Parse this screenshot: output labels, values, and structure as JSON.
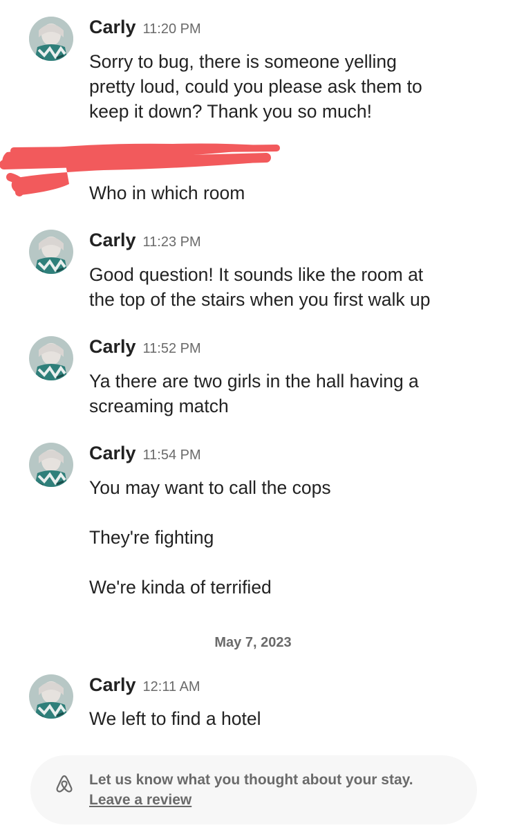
{
  "messages": [
    {
      "name": "Carly",
      "time": "11:20 PM",
      "lines": [
        "Sorry to bug, there is someone yelling",
        "pretty loud, could you please ask them to",
        "keep it down? Thank you so much!"
      ]
    },
    {
      "lines": [
        "Who in which room"
      ]
    },
    {
      "name": "Carly",
      "time": "11:23 PM",
      "lines": [
        "Good question! It sounds like the room at",
        "the top of the stairs when you first walk up"
      ]
    },
    {
      "name": "Carly",
      "time": "11:52 PM",
      "lines": [
        "Ya there are two girls in the hall having a",
        "screaming match"
      ]
    },
    {
      "name": "Carly",
      "time": "11:54 PM",
      "lines": [
        "You may want to call the cops",
        "They're fighting",
        "We're kinda of terrified"
      ]
    },
    {
      "name": "Carly",
      "time": "12:11 AM",
      "lines": [
        "We left to find a hotel"
      ]
    }
  ],
  "date_separator": "May 7, 2023",
  "review_prompt": {
    "text": "Let us know what you thought about your stay.",
    "link": "Leave a review"
  },
  "colors": {
    "text": "#222222",
    "muted": "#6a6a6a",
    "redaction": "#f25a5c",
    "bar_bg": "#f7f7f7"
  },
  "icons": {
    "avatar": "user-photo-avatar",
    "review": "airbnb-logo-icon"
  }
}
